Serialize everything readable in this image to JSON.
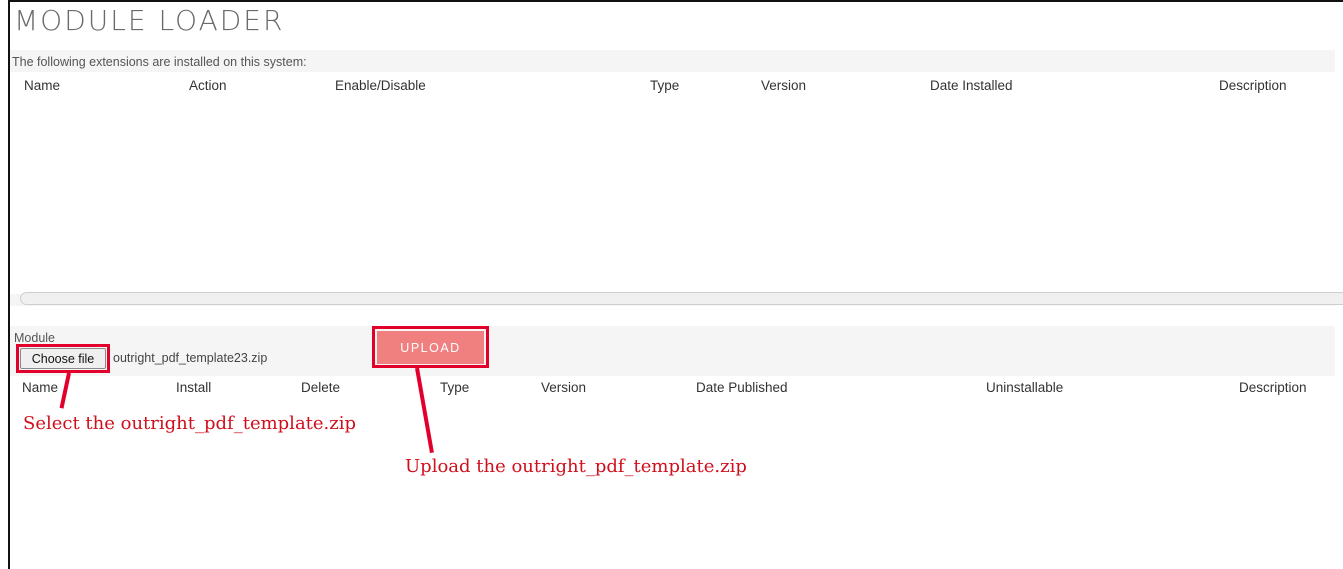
{
  "page": {
    "title": "MODULE LOADER"
  },
  "installed": {
    "caption": "The following extensions are installed on this system:",
    "columns": [
      "Name",
      "Action",
      "Enable/Disable",
      "Type",
      "Version",
      "Date Installed",
      "Description"
    ],
    "rows": []
  },
  "module_form": {
    "label": "Module",
    "choose_file_label": "Choose file",
    "selected_file": "outright_pdf_template23.zip",
    "upload_label": "UPLOAD"
  },
  "available": {
    "columns": [
      "Name",
      "Install",
      "Delete",
      "Type",
      "Version",
      "Date Published",
      "Uninstallable",
      "Description"
    ],
    "rows": []
  },
  "annotations": {
    "select_note": "Select the outright_pdf_template.zip",
    "upload_note": "Upload the outright_pdf_template.zip",
    "highlight_color": "#e2002b"
  },
  "colors": {
    "upload_button": "#f08080",
    "annotation_text": "#d10f1c"
  }
}
